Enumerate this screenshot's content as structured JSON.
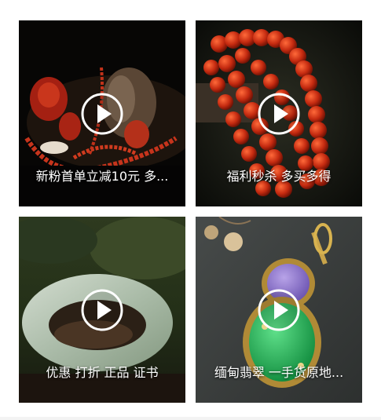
{
  "cards": [
    {
      "title": "新粉首单立减10元 多...",
      "icon": "play-icon"
    },
    {
      "title": "福利秒杀 多买多得",
      "icon": "play-icon"
    },
    {
      "title": "优惠 打折 正品 证书",
      "icon": "play-icon"
    },
    {
      "title": "缅甸翡翠 一手货原地...",
      "icon": "play-icon"
    }
  ]
}
